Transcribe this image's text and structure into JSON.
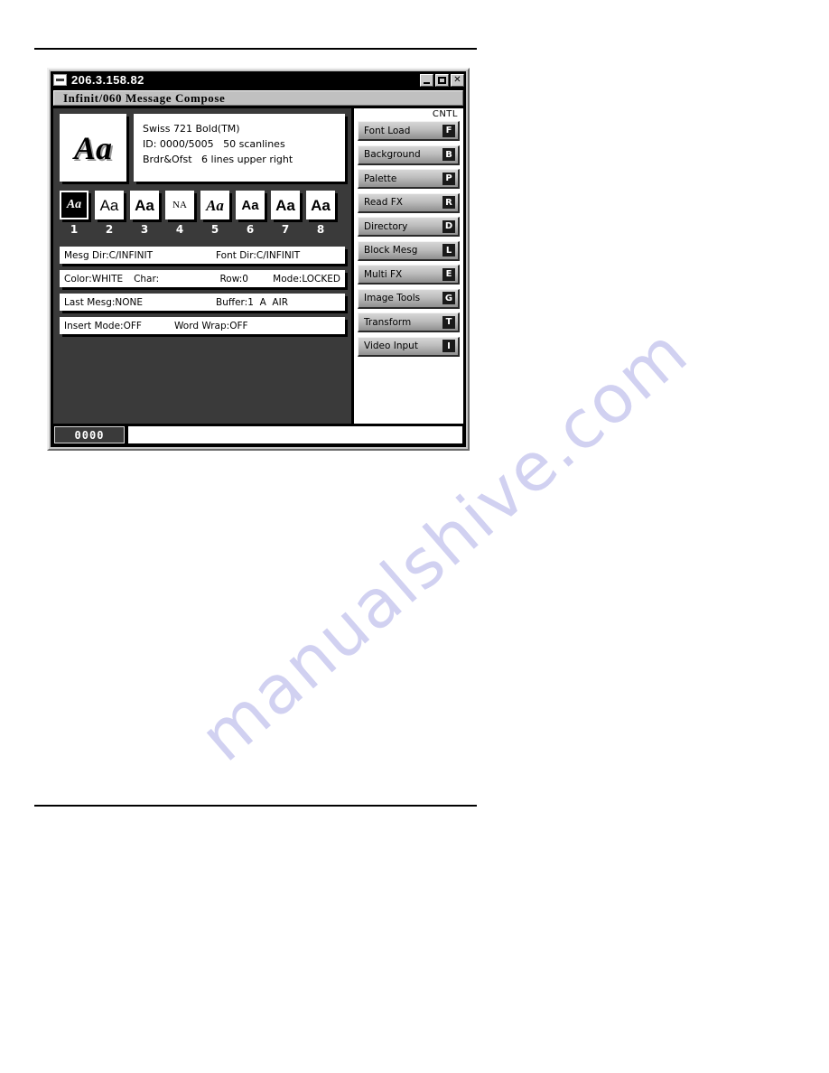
{
  "page": {
    "watermark": "manualshive.com"
  },
  "window": {
    "title": "206.3.158.82",
    "sysicon": "system-menu-icon",
    "buttons": {
      "minimize": "_",
      "maximize": "□",
      "close": "✕"
    }
  },
  "app": {
    "header": "Infinit/060   Message Compose"
  },
  "preview": {
    "glyph": "Aa",
    "info": [
      "Swiss 721 Bold(TM)",
      "ID: 0000/5005   50 scanlines",
      "Brdr&Ofst   6 lines upper right"
    ]
  },
  "font_slots": [
    {
      "number": "1",
      "glyph": "Aa",
      "style": "selected",
      "selected": true
    },
    {
      "number": "2",
      "glyph": "Aa",
      "style": "sans",
      "selected": false
    },
    {
      "number": "3",
      "glyph": "Aa",
      "style": "sans-bold",
      "selected": false
    },
    {
      "number": "4",
      "glyph": "NA",
      "style": "na",
      "selected": false
    },
    {
      "number": "5",
      "glyph": "Aa",
      "style": "italic-serif",
      "selected": false
    },
    {
      "number": "6",
      "glyph": "Aa",
      "style": "cond",
      "selected": false
    },
    {
      "number": "7",
      "glyph": "Aa",
      "style": "sans-bold",
      "selected": false
    },
    {
      "number": "8",
      "glyph": "Aa",
      "style": "sans-bold",
      "selected": false
    }
  ],
  "status": {
    "line1": {
      "mesg_dir": "Mesg Dir:C/INFINIT",
      "font_dir": "Font Dir:C/INFINIT"
    },
    "line2": {
      "color": "Color:WHITE",
      "char": "Char:",
      "row": "Row:0",
      "mode": "Mode:LOCKED"
    },
    "line3": {
      "last_mesg": "Last Mesg:NONE",
      "buffer": "Buffer:1  A  AIR"
    },
    "line4": {
      "insert_mode": "Insert Mode:OFF",
      "word_wrap": "Word Wrap:OFF"
    }
  },
  "cntl": {
    "label": "CNTL",
    "buttons": [
      {
        "label": "Font Load",
        "key": "F"
      },
      {
        "label": "Background",
        "key": "B"
      },
      {
        "label": "Palette",
        "key": "P"
      },
      {
        "label": "Read FX",
        "key": "R"
      },
      {
        "label": "Directory",
        "key": "D"
      },
      {
        "label": "Block Mesg",
        "key": "L"
      },
      {
        "label": "Multi FX",
        "key": "E"
      },
      {
        "label": "Image Tools",
        "key": "G"
      },
      {
        "label": "Transform",
        "key": "T"
      },
      {
        "label": "Video Input",
        "key": "I"
      }
    ]
  },
  "bottom": {
    "counter": "0000",
    "entry_value": ""
  }
}
